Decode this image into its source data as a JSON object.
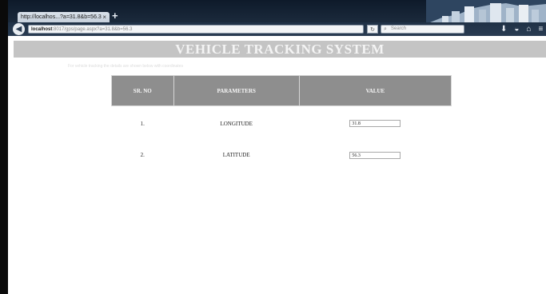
{
  "browser": {
    "tab_title": "http://localhos...?a=31.8&b=56.3",
    "tab_close": "×",
    "new_tab": "+",
    "url_host": "localhost",
    "url_rest": ":8017/gps/page.aspx?a=31.8&b=56.3",
    "search_placeholder": "Search"
  },
  "page": {
    "title": "VEHICLE TRACKING SYSTEM",
    "subline": "For vehicle tracking the details are shown below with coordinates"
  },
  "table": {
    "headers": [
      "SR. NO",
      "PARAMETERS",
      "VALUE"
    ],
    "rows": [
      {
        "sr": "1.",
        "parameter": "LONGITUDE",
        "value": "31.8"
      },
      {
        "sr": "2.",
        "parameter": "LATITUDE",
        "value": "56.3"
      }
    ]
  },
  "icons": {
    "back": "back-arrow-icon",
    "reload": "reload-icon",
    "search": "search-icon",
    "download": "download-icon",
    "pocket": "pocket-icon",
    "home": "home-icon",
    "menu": "menu-icon"
  },
  "colors": {
    "header_bar": "#c4c4c4",
    "table_header": "#8e8e8e",
    "browser_chrome": "#1f3146"
  }
}
